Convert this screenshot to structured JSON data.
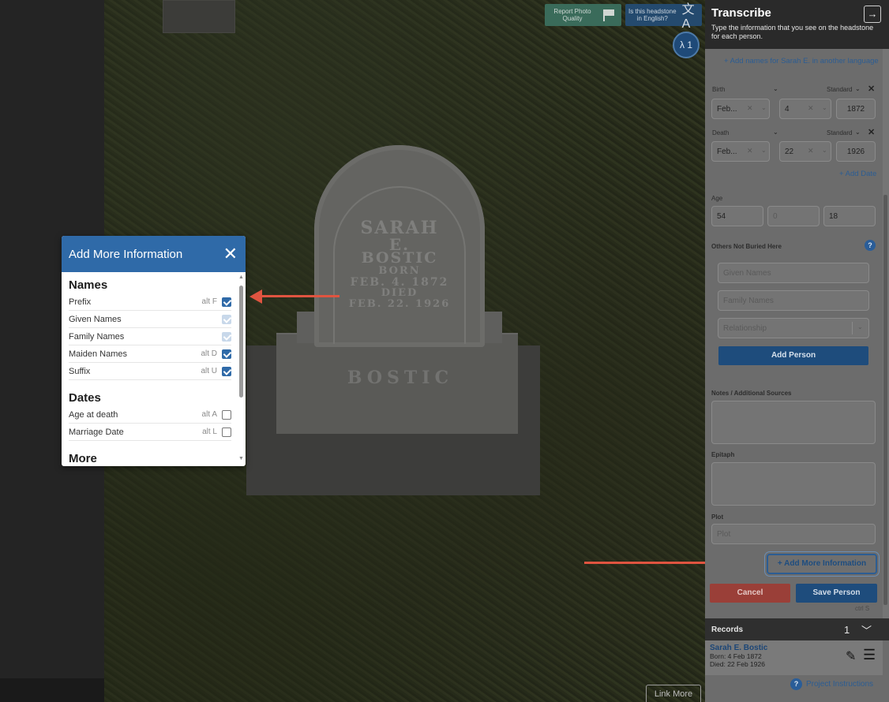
{
  "photo": {
    "stone_lines": [
      "SARAH",
      "E.",
      "BOSTIC",
      "BORN",
      "FEB. 4. 1872",
      "DIED",
      "FEB. 22. 1926"
    ],
    "base_text": "BOSTIC",
    "report_photo_label": "Report Photo Quality",
    "language_label": "Is this headstone in English?",
    "people_badge": "λ 1",
    "link_more_label": "Link More"
  },
  "popup": {
    "title": "Add More Information",
    "sections": [
      {
        "title": "Names",
        "items": [
          {
            "label": "Prefix",
            "shortcut": "alt F",
            "state": "on"
          },
          {
            "label": "Given Names",
            "shortcut": "",
            "state": "dis"
          },
          {
            "label": "Family Names",
            "shortcut": "",
            "state": "dis"
          },
          {
            "label": "Maiden Names",
            "shortcut": "alt D",
            "state": "on"
          },
          {
            "label": "Suffix",
            "shortcut": "alt U",
            "state": "on"
          }
        ]
      },
      {
        "title": "Dates",
        "items": [
          {
            "label": "Age at death",
            "shortcut": "alt A",
            "state": "off"
          },
          {
            "label": "Marriage Date",
            "shortcut": "alt L",
            "state": "off"
          }
        ]
      },
      {
        "title": "More",
        "items": []
      }
    ]
  },
  "panel": {
    "title": "Transcribe",
    "subtitle": "Type the information that you see on the headstone for each person.",
    "add_names_link": "+ Add names for Sarah E. in another language",
    "birth": {
      "label": "Birth",
      "mode": "Standard",
      "month": "Feb...",
      "day": "4",
      "year": "1872"
    },
    "death": {
      "label": "Death",
      "mode": "Standard",
      "month": "Feb...",
      "day": "22",
      "year": "1926"
    },
    "add_date_link": "+ Add Date",
    "age": {
      "label": "Age",
      "years": "54",
      "months_placeholder": "0",
      "days": "18"
    },
    "others": {
      "label": "Others Not Buried Here",
      "given_placeholder": "Given Names",
      "family_placeholder": "Family Names",
      "relationship_placeholder": "Relationship",
      "add_person_label": "Add Person"
    },
    "notes_label": "Notes / Additional Sources",
    "epitaph_label": "Epitaph",
    "plot_label": "Plot",
    "plot_placeholder": "Plot",
    "add_more_label": "+ Add More Information",
    "cancel_label": "Cancel",
    "save_label": "Save Person",
    "save_shortcut": "ctrl S",
    "records": {
      "label": "Records",
      "count": "1",
      "items": [
        {
          "name": "Sarah E. Bostic",
          "born": "Born: 4 Feb 1872",
          "died": "Died: 22 Feb 1926"
        }
      ]
    },
    "project_instructions": "Project Instructions"
  },
  "colors": {
    "accent": "#2f6aa8",
    "arrow": "#e05440",
    "cancel": "#9a3f38",
    "save": "#1e4c7c"
  }
}
